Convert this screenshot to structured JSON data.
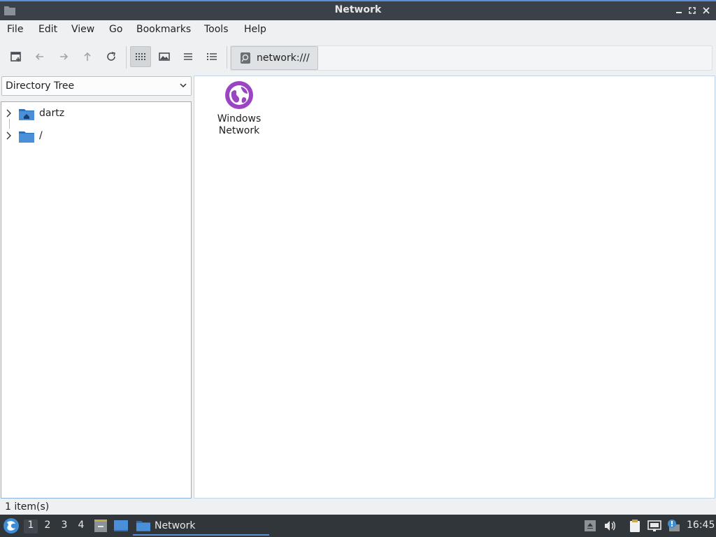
{
  "window": {
    "title": "Network"
  },
  "menubar": {
    "items": [
      "File",
      "Edit",
      "View",
      "Go",
      "Bookmarks",
      "Tools",
      "Help"
    ]
  },
  "toolbar": {
    "path_button": "network:///"
  },
  "side_panel": {
    "mode": "Directory Tree",
    "tree": [
      {
        "label": "dartz",
        "icon": "home-folder-icon"
      },
      {
        "label": "/",
        "icon": "folder-icon"
      }
    ]
  },
  "main": {
    "items": [
      {
        "label_line1": "Windows",
        "label_line2": "Network",
        "icon": "network-globe-icon"
      }
    ]
  },
  "status": {
    "text": "1 item(s)"
  },
  "taskbar": {
    "workspaces": [
      "1",
      "2",
      "3",
      "4"
    ],
    "active_task": "Network",
    "clock": "16:45"
  },
  "colors": {
    "accent": "#5c8fd6",
    "network_icon": "#9b45c4",
    "folder": "#4a90d9"
  }
}
